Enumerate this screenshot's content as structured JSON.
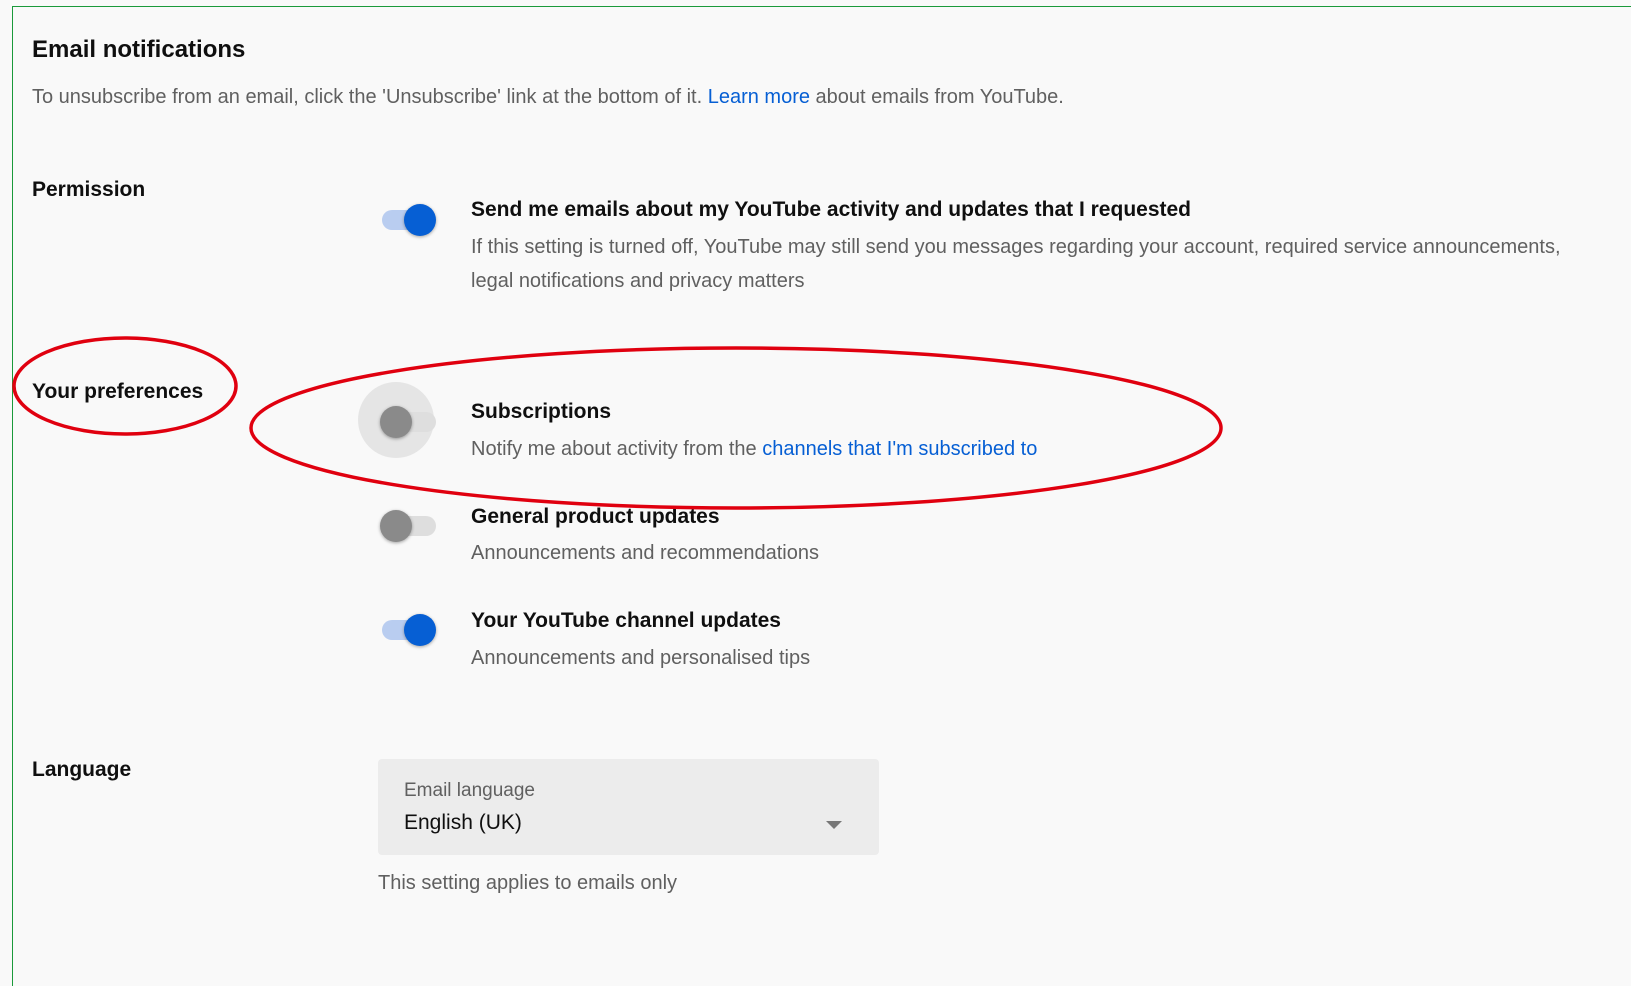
{
  "header": {
    "title": "Email notifications",
    "intro_before": "To unsubscribe from an email, click the 'Unsubscribe' link at the bottom of it. ",
    "intro_link": "Learn more",
    "intro_after": " about emails from YouTube."
  },
  "sections": {
    "permission": "Permission",
    "preferences": "Your preferences",
    "language": "Language"
  },
  "options": {
    "activity": {
      "title": "Send me emails about my YouTube activity and updates that I requested",
      "desc": "If this setting is turned off, YouTube may still send you messages regarding your account, required service announcements, legal notifications and privacy matters",
      "enabled": true
    },
    "subscriptions": {
      "title": "Subscriptions",
      "desc_before": "Notify me about activity from the ",
      "desc_link": "channels that I'm subscribed to",
      "enabled": false
    },
    "product": {
      "title": "General product updates",
      "desc": "Announcements and recommendations",
      "enabled": false
    },
    "channel": {
      "title": "Your YouTube channel updates",
      "desc": "Announcements and personalised tips",
      "enabled": true
    }
  },
  "language": {
    "select_label": "Email language",
    "select_value": "English (UK)",
    "helper": "This setting applies to emails only"
  },
  "colors": {
    "accent": "#065fd4",
    "annotation": "#e0000f",
    "frame": "#1a9a3a"
  }
}
